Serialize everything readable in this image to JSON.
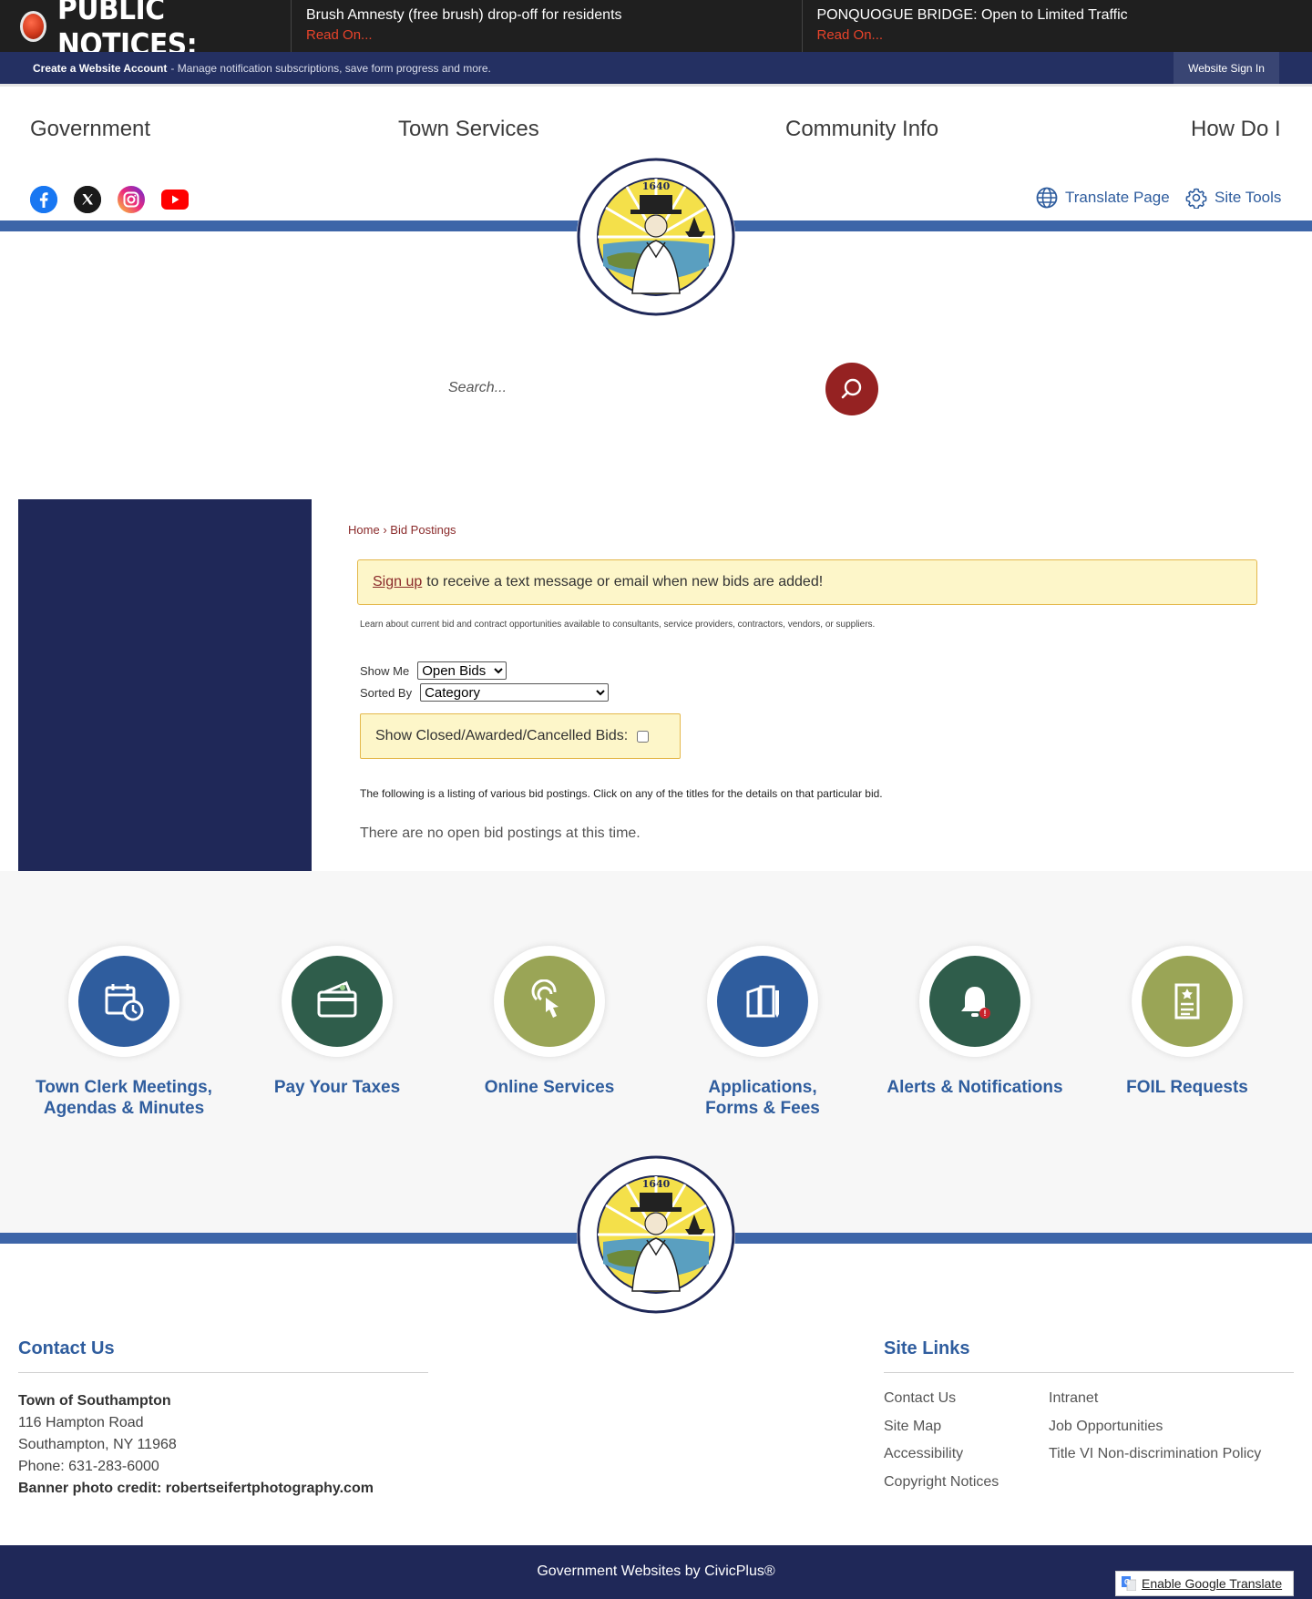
{
  "alert": {
    "label": "PUBLIC NOTICES:",
    "notices": [
      {
        "title": "Brush Amnesty (free brush) drop-off for residents",
        "read": "Read On..."
      },
      {
        "title": "PONQUOGUE BRIDGE: Open to Limited Traffic",
        "read": "Read On..."
      }
    ]
  },
  "account": {
    "create": "Create a Website Account",
    "desc": "- Manage notification subscriptions, save form progress and more.",
    "signin": "Website Sign In"
  },
  "nav": [
    "Government",
    "Town Services",
    "Community Info",
    "How Do I"
  ],
  "social": [
    {
      "icon": "facebook-icon",
      "color": "#1877f2"
    },
    {
      "icon": "x-twitter-icon",
      "color": "#111111"
    },
    {
      "icon": "instagram-icon",
      "color": "#d62976"
    },
    {
      "icon": "youtube-icon",
      "color": "#ff0000"
    }
  ],
  "tools": {
    "translate": "Translate Page",
    "site_tools": "Site Tools"
  },
  "seal": {
    "year": "1640"
  },
  "search": {
    "placeholder": "Search..."
  },
  "content": {
    "breadcrumb_home": "Home",
    "breadcrumb_sep": "›",
    "breadcrumb_current": "Bid Postings",
    "signup_link": "Sign up",
    "signup_text": "to receive a text message or email when new bids are added!",
    "intro": "Learn about current bid and contract opportunities available to consultants, service providers, contractors, vendors, or suppliers.",
    "show_me_label": "Show Me",
    "show_me_value": "Open Bids",
    "sorted_by_label": "Sorted By",
    "sorted_by_value": "Category",
    "closed_label": "Show Closed/Awarded/Cancelled Bids:",
    "listing_note": "The following is a listing of various bid postings. Click on any of the titles for the details on that particular bid.",
    "no_bids": "There are no open bid postings at this time."
  },
  "quick_links": [
    {
      "line1": "Town Clerk Meetings,",
      "line2": "Agendas & Minutes",
      "icon": "calendar-clock-icon",
      "color": "#2f5d9e"
    },
    {
      "line1": "Pay Your Taxes",
      "line2": "",
      "icon": "credit-card-icon",
      "color": "#2f5d4b"
    },
    {
      "line1": "Online Services",
      "line2": "",
      "icon": "touch-icon",
      "color": "#9aa556"
    },
    {
      "line1": "Applications,",
      "line2": "Forms & Fees",
      "icon": "documents-icon",
      "color": "#2f5d9e"
    },
    {
      "line1": "Alerts & Notifications",
      "line2": "",
      "icon": "bell-icon",
      "color": "#2f5d4b"
    },
    {
      "line1": "FOIL Requests",
      "line2": "",
      "icon": "foil-document-icon",
      "color": "#9aa556"
    }
  ],
  "footer": {
    "contact_heading": "Contact Us",
    "org": "Town of Southampton",
    "address1": "116 Hampton Road",
    "address2": "Southampton, NY 11968",
    "phone": "Phone: 631-283-6000",
    "credit": "Banner photo credit: robertseifertphotography.com",
    "links_heading": "Site Links",
    "links_col1": [
      "Contact Us",
      "Site Map",
      "Accessibility",
      "Copyright Notices"
    ],
    "links_col2": [
      "Intranet",
      "Job Opportunities",
      "Title VI Non-discrimination Policy"
    ],
    "civic": "Government Websites by CivicPlus®",
    "google_translate": "Enable Google Translate"
  }
}
